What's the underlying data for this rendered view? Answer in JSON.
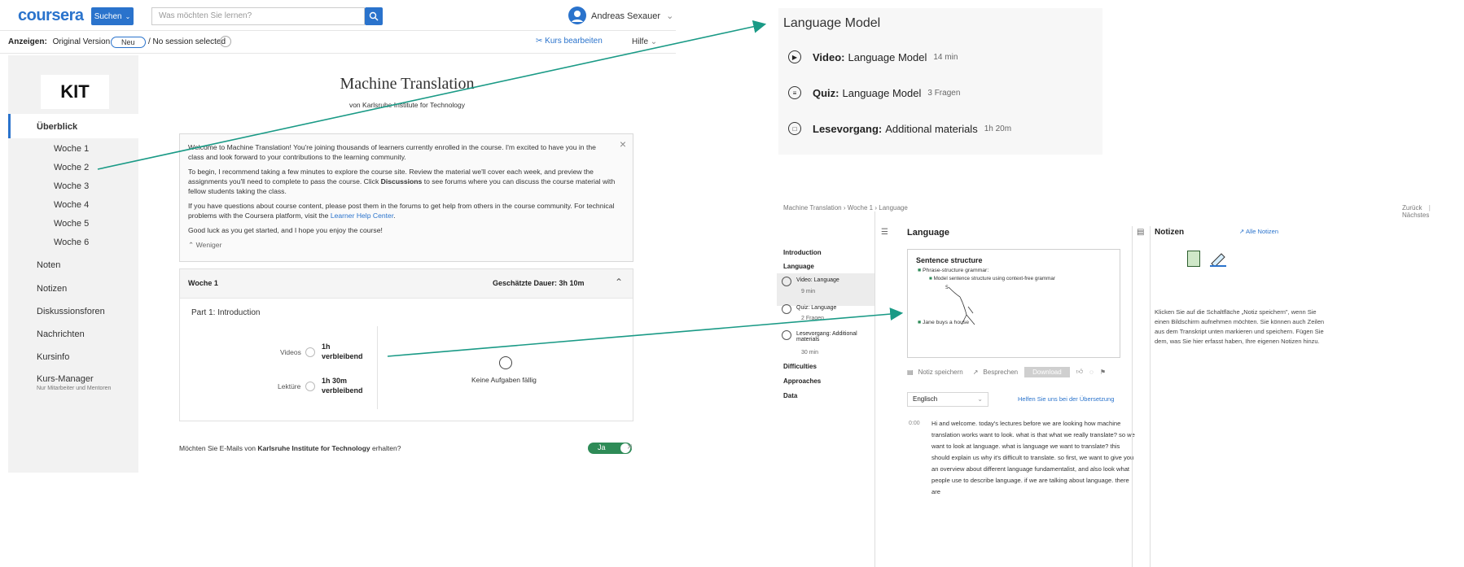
{
  "left": {
    "brand": "coursera",
    "search_button": "Suchen",
    "search_placeholder": "Was möchten Sie lernen?",
    "user_name": "Andreas Sexauer",
    "subbar": {
      "label": "Anzeigen:",
      "version": "Original Version",
      "pill": "Neu",
      "session": "/ No session selected",
      "edit": "Kurs bearbeiten",
      "help": "Hilfe"
    },
    "sidebar": {
      "logo": "KIT",
      "items": [
        {
          "label": "Überblick"
        },
        {
          "label": "Woche 1"
        },
        {
          "label": "Woche 2"
        },
        {
          "label": "Woche 3"
        },
        {
          "label": "Woche 4"
        },
        {
          "label": "Woche 5"
        },
        {
          "label": "Woche 6"
        },
        {
          "label": "Noten"
        },
        {
          "label": "Notizen"
        },
        {
          "label": "Diskussionsforen"
        },
        {
          "label": "Nachrichten"
        },
        {
          "label": "Kursinfo"
        },
        {
          "label": "Kurs-Manager"
        }
      ],
      "manager_sub": "Nur Mitarbeiter und Mentoren"
    },
    "course": {
      "title": "Machine Translation",
      "subtitle": "von Karlsruhe Institute for Technology",
      "welcome": {
        "p1": "Welcome to Machine Translation! You're joining thousands of learners currently enrolled in the course. I'm excited to have you in the class and look forward to your contributions to the learning community.",
        "p2_pre": "To begin, I recommend taking a few minutes to explore the course site. Review the material we'll cover each week, and preview the assignments you'll need to complete to pass the course. Click",
        "p2_bold": "Discussions",
        "p2_post": "to see forums where you can discuss the course material with fellow students taking the class.",
        "p3_pre": "If you have questions about course content, please post them in the forums to get help from others in the course community. For technical problems with the Coursera platform, visit the",
        "p3_link": "Learner Help Center",
        "p3_post": ".",
        "p4": "Good luck as you get started, and I hope you enjoy the course!",
        "less": "Weniger"
      },
      "week": {
        "label": "Woche 1",
        "duration": "Geschätzte Dauer: 3h 10m",
        "part": "Part 1: Introduction",
        "videos_label": "Videos",
        "videos_remaining": "1h",
        "videos_remaining2": "verbleibend",
        "reading_label": "Lektüre",
        "reading_remaining": "1h 30m",
        "reading_remaining2": "verbleibend",
        "no_tasks": "Keine Aufgaben fällig"
      },
      "email_pre": "Möchten Sie E-Mails von",
      "email_bold": "Karlsruhe Institute for Technology",
      "email_post": "erhalten?",
      "toggle": "Ja"
    }
  },
  "zoom": {
    "title": "Language Model",
    "items": [
      {
        "type": "Video:",
        "name": "Language Model",
        "meta": "14 min"
      },
      {
        "type": "Quiz:",
        "name": "Language Model",
        "meta": "3 Fragen"
      },
      {
        "type": "Lesevorgang:",
        "name": "Additional materials",
        "meta": "1h 20m"
      }
    ]
  },
  "lecture": {
    "breadcrumb": "Machine Translation  ›  Woche 1  ›  Language",
    "back": "Zurück",
    "next": "Nächstes",
    "nav": {
      "introduction": "Introduction",
      "language": "Language",
      "video": "Video: Language",
      "video_meta": "9 min",
      "quiz": "Quiz: Language",
      "quiz_meta": "2 Fragen",
      "reading": "Lesevorgang: Additional materials",
      "reading_meta": "30 min",
      "difficulties": "Difficulties",
      "approaches": "Approaches",
      "data": "Data"
    },
    "content_title": "Language",
    "slide": {
      "title": "Sentence structure",
      "b1": "Phrase-structure grammar:",
      "b1a": "Model sentence structure using context-free grammar",
      "b2": "Jane buys a house"
    },
    "actions": {
      "save": "Notiz speichern",
      "discuss": "Besprechen",
      "download": "Download"
    },
    "language": "Englisch",
    "help_translate": "Helfen Sie uns bei der Übersetzung",
    "time": "0:00",
    "transcript": "Hi and welcome. today's lectures before we are looking how machine translation works want to look. what is that what we really translate? so we want to look at language. what is language we want to translate? this should explain us why it's difficult to translate. so first, we want to give you an overview about different language fundamentalist, and also look what people use to describe language. if we are talking about language. there are",
    "notes": {
      "title": "Notizen",
      "all": "Alle Notizen",
      "text": "Klicken Sie auf die Schaltfläche „Notiz speichern\", wenn Sie einen Bildschirm aufnehmen möchten. Sie können auch Zeilen aus dem Transkript unten markieren und speichern. Fügen Sie dem, was Sie hier erfasst haben, Ihre eigenen Notizen hinzu."
    }
  },
  "colors": {
    "accent": "#2a73cc",
    "arrow": "#1a9a86",
    "toggle": "#2e8b57"
  }
}
